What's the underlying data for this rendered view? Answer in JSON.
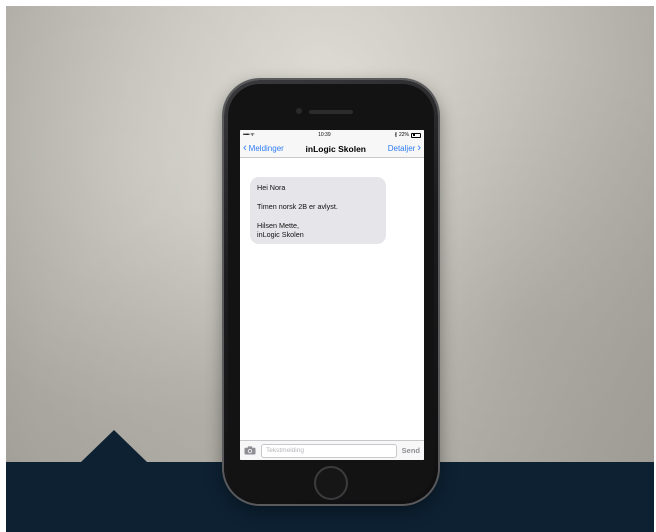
{
  "status_bar": {
    "signal": "••••• ᯤ",
    "time": "10:39",
    "battery_text": "22%",
    "bluetooth": "∦"
  },
  "nav": {
    "back_label": "Meldinger",
    "title": "inLogic Skolen",
    "details_label": "Detaljer"
  },
  "message": {
    "line1": "Hei Nora",
    "line2": "Timen norsk 2B er avlyst.",
    "line3": "Hilsen Mette,",
    "line4": "inLogic Skolen"
  },
  "input": {
    "placeholder": "Tekstmelding",
    "send_label": "Send"
  },
  "colors": {
    "accent": "#2f7cf6",
    "bubble": "#e5e5ea",
    "floor": "#0d2133"
  },
  "icons": {
    "back": "chevron-left-icon",
    "details": "chevron-right-icon",
    "camera": "camera-icon"
  }
}
